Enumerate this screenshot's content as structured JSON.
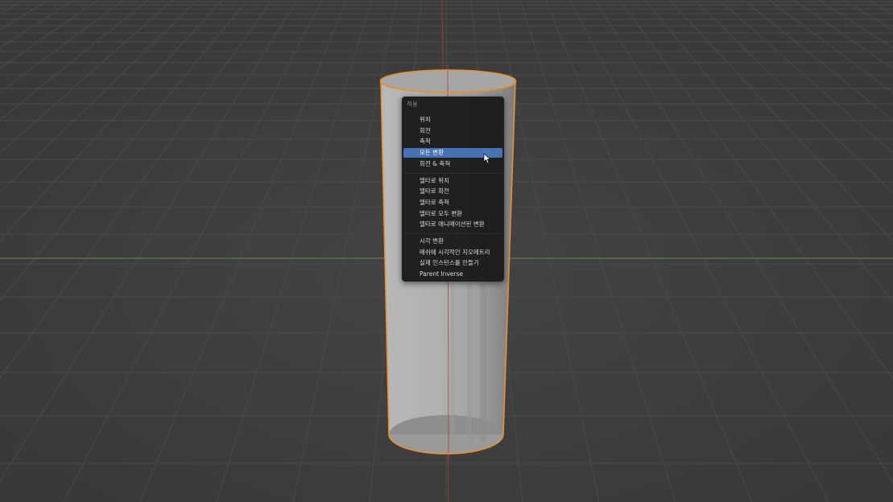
{
  "viewport": {
    "background_color": "#3d3d3d",
    "grid_color": "#4a4a4a",
    "x_axis_color": "#7a9c3a",
    "z_axis_color": "#a33a3a",
    "object": {
      "name": "cylinder",
      "selected": true,
      "outline_color": "#e8912e",
      "body_color": "#a9a9a9"
    }
  },
  "apply_menu": {
    "title": "적용",
    "groups": [
      [
        {
          "label": "위치",
          "active": false
        },
        {
          "label": "회전",
          "active": false
        },
        {
          "label": "축척",
          "active": false
        },
        {
          "label": "모든 변환",
          "active": true
        },
        {
          "label": "회전 & 축척",
          "active": false
        }
      ],
      [
        {
          "label": "델타로 위치",
          "active": false
        },
        {
          "label": "델타로 회전",
          "active": false
        },
        {
          "label": "델타로 축척",
          "active": false
        },
        {
          "label": "델타로 모두 변환",
          "active": false
        },
        {
          "label": "델타로 애니메이션된 변환",
          "active": false
        }
      ],
      [
        {
          "label": "시각 변환",
          "active": false
        },
        {
          "label": "메쉬에 시각적인 지오메트리",
          "active": false
        },
        {
          "label": "실제 인스턴스를 만들기",
          "active": false
        },
        {
          "label": "Parent Inverse",
          "active": false
        }
      ]
    ],
    "highlight_color": "#4772b3",
    "cursor_icon": "mouse-pointer-icon"
  }
}
